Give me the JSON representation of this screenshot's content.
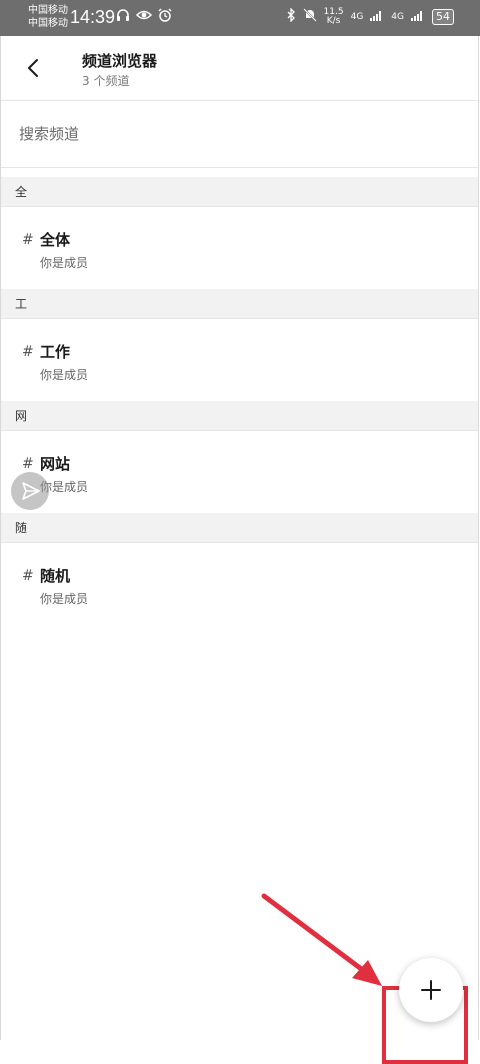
{
  "status_bar": {
    "carrier_1": "中国移动",
    "carrier_2": "中国移动",
    "time": "14:39",
    "net_speed_value": "11.5",
    "net_speed_unit": "K/s",
    "signal_1": "4G",
    "signal_2": "4G",
    "battery": "54"
  },
  "header": {
    "title": "频道浏览器",
    "subtitle": "3 个频道"
  },
  "search": {
    "placeholder": "搜索频道"
  },
  "sections": [
    {
      "letter": "全",
      "channel": {
        "name": "全体",
        "status": "你是成员"
      }
    },
    {
      "letter": "工",
      "channel": {
        "name": "工作",
        "status": "你是成员"
      }
    },
    {
      "letter": "网",
      "channel": {
        "name": "网站",
        "status": "你是成员"
      }
    },
    {
      "letter": "随",
      "channel": {
        "name": "随机",
        "status": "你是成员"
      }
    }
  ],
  "hash_symbol": "#",
  "colors": {
    "annotation_red": "#e0303f",
    "status_bar_bg": "#6e6e6e",
    "section_bg": "#f2f2f2"
  },
  "icons": {
    "back": "arrow-left-icon",
    "fab": "plus-icon",
    "floating": "send-icon"
  }
}
